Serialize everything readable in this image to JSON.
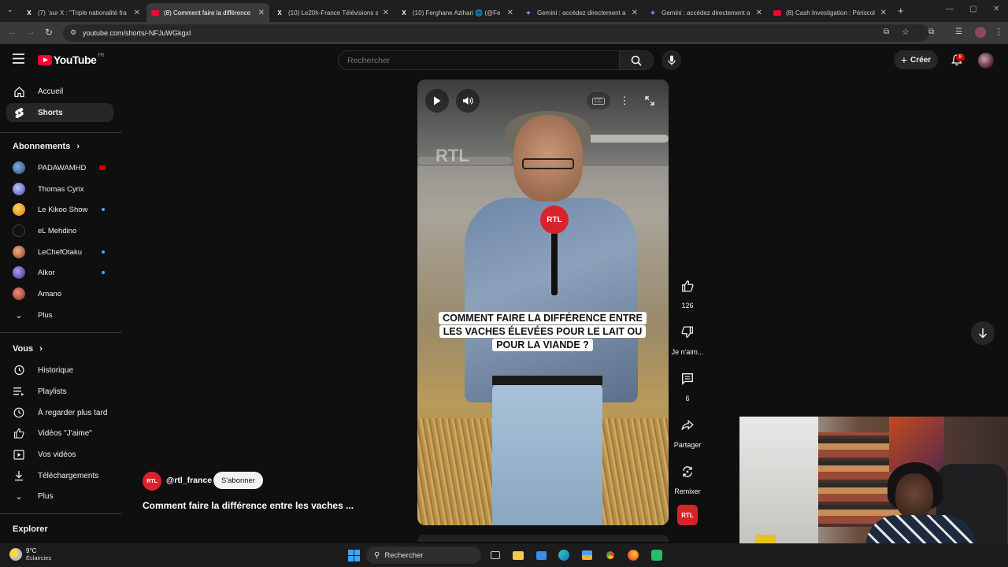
{
  "browser": {
    "tabs": [
      {
        "title": "(7) ʿsur X : \"Triple nationalité fra",
        "icon": "x-icon"
      },
      {
        "title": "(8) Comment faire la différence",
        "icon": "youtube-icon",
        "active": true
      },
      {
        "title": "(10) Le20h-France Télévisions s",
        "icon": "x-icon"
      },
      {
        "title": "(10) Ferghane Azihari 🌐 (@Fe",
        "icon": "x-icon"
      },
      {
        "title": "Gemini : accédez directement a",
        "icon": "gemini-icon"
      },
      {
        "title": "Gemini : accédez directement a",
        "icon": "gemini-icon"
      },
      {
        "title": "(8) Cash Investigation : Périscol",
        "icon": "youtube-icon"
      }
    ],
    "new_tab": "+",
    "url": "youtube.com/shorts/-NFJuWGkgxI"
  },
  "masthead": {
    "logo_text": "YouTube",
    "country_code": "FR",
    "search_placeholder": "Rechercher",
    "create_label": "Créer",
    "notification_count": "8"
  },
  "sidebar": {
    "main": [
      {
        "label": "Accueil",
        "icon": "home-icon"
      },
      {
        "label": "Shorts",
        "icon": "shorts-icon",
        "active": true
      }
    ],
    "subscriptions_header": "Abonnements",
    "subscriptions": [
      {
        "label": "PADAWAMHD",
        "color": "#4a7cc9",
        "live": true
      },
      {
        "label": "Thomas Cyrix",
        "color": "#5a6fd8",
        "dot": false
      },
      {
        "label": "Le Kikoo Show",
        "color": "#f0a020",
        "dot": true
      },
      {
        "label": "eL Mehdino",
        "color": "#2a2a2a",
        "dot": false
      },
      {
        "label": "LeChefOtaku",
        "color": "#c8643a",
        "dot": true
      },
      {
        "label": "Alkor",
        "color": "#6a5ac8",
        "dot": true
      },
      {
        "label": "Amano",
        "color": "#c85a4a",
        "dot": false
      }
    ],
    "subscriptions_more": "Plus",
    "you_header": "Vous",
    "you_items": [
      {
        "label": "Historique",
        "icon": "history-icon"
      },
      {
        "label": "Playlists",
        "icon": "playlist-icon"
      },
      {
        "label": "À regarder plus tard",
        "icon": "clock-icon"
      },
      {
        "label": "Vidéos \"J'aime\"",
        "icon": "thumb-up-icon"
      },
      {
        "label": "Vos vidéos",
        "icon": "video-icon"
      },
      {
        "label": "Téléchargements",
        "icon": "download-icon"
      }
    ],
    "you_more": "Plus",
    "explore_header": "Explorer"
  },
  "short": {
    "caption": "COMMENT FAIRE LA DIFFÉRENCE ENTRE LES VACHES ÉLEVÉES POUR LE LAIT OU POUR LA VIANDE ?",
    "mic_logo": "RTL",
    "watermark": "RTL",
    "channel_handle": "@rtl_france",
    "channel_avatar_text": "RTL",
    "subscribe_label": "S'abonner",
    "title": "Comment faire la différence entre les vaches ..."
  },
  "actions": {
    "like_count": "126",
    "dislike_label": "Je n'aim...",
    "comment_count": "6",
    "share_label": "Partager",
    "remix_label": "Remixer",
    "sound_chip": "RTL"
  },
  "taskbar": {
    "temperature": "9°C",
    "weather": "Éclaircies",
    "search_label": "Rechercher"
  },
  "colors": {
    "youtube_red": "#ff0033",
    "rtl_red": "#d8232a",
    "background": "#0f0f0f"
  }
}
